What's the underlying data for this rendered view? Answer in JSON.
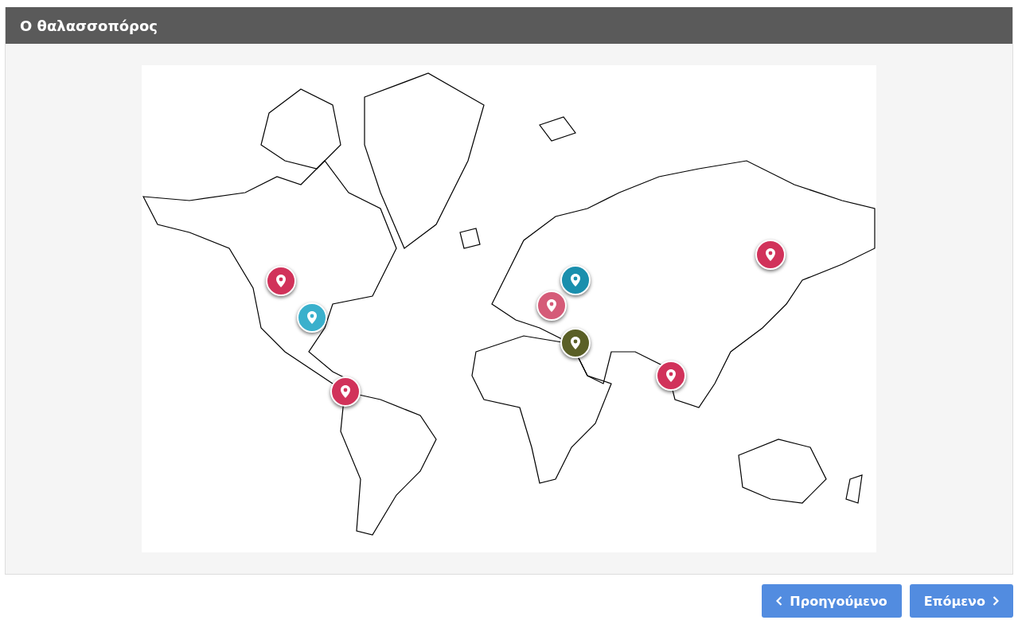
{
  "panel": {
    "title": "Ο θαλασσοπόρος"
  },
  "map": {
    "pins": [
      {
        "color": "#d1325a"
      },
      {
        "color": "#3ab0cc"
      },
      {
        "color": "#d1325a"
      },
      {
        "color": "#1a8fad"
      },
      {
        "color": "#d55b78"
      },
      {
        "color": "#5a5f26"
      },
      {
        "color": "#d1325a"
      },
      {
        "color": "#d1325a"
      }
    ]
  },
  "buttons": [
    {
      "kind": "prev",
      "label": "Προηγούμενο"
    },
    {
      "kind": "next",
      "label": "Επόμενο"
    }
  ]
}
